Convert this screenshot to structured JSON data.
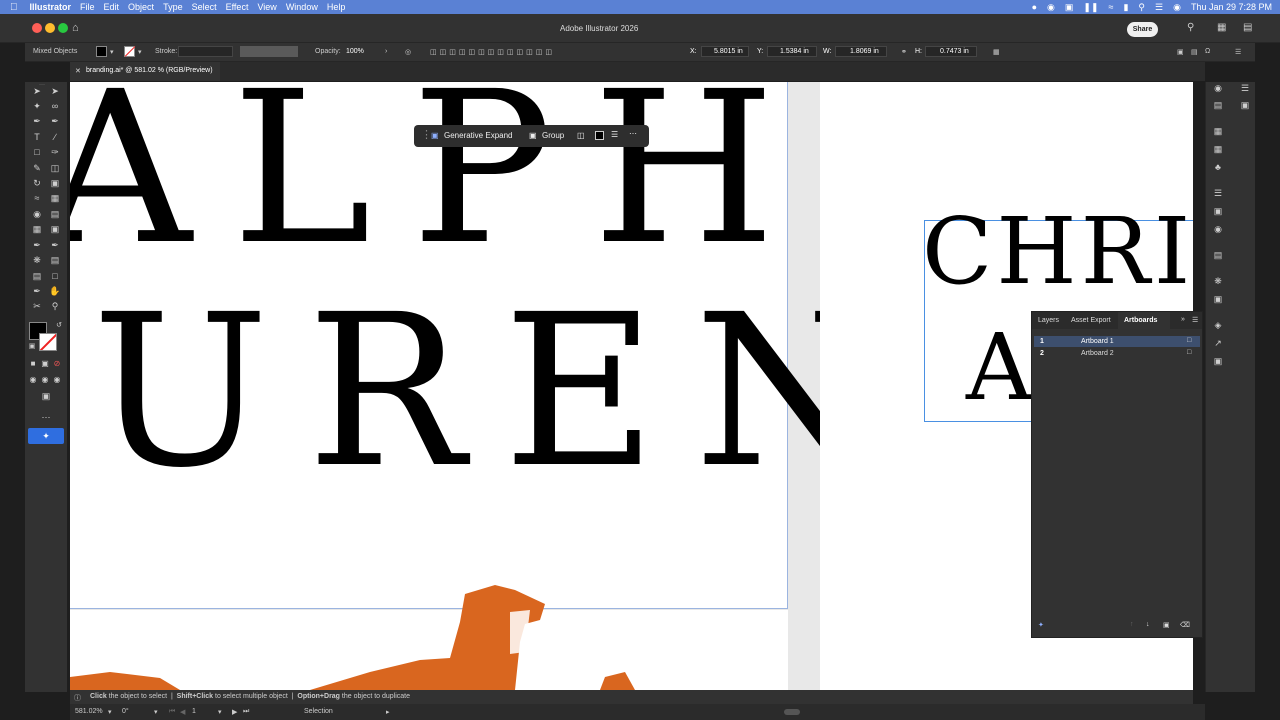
{
  "menubar": {
    "app": "Illustrator",
    "items": [
      "File",
      "Edit",
      "Object",
      "Type",
      "Select",
      "Effect",
      "View",
      "Window",
      "Help"
    ],
    "datetime": "Thu Jan 29  7:28 PM"
  },
  "window": {
    "title": "Adobe Illustrator 2026",
    "share_label": "Share"
  },
  "control": {
    "selection_type": "Mixed Objects",
    "stroke_label": "Stroke:",
    "opacity_label": "Opacity:",
    "opacity_value": "100%",
    "x_label": "X:",
    "x_value": "5.8015 in",
    "y_label": "Y:",
    "y_value": "1.5384 in",
    "w_label": "W:",
    "w_value": "1.8069 in",
    "h_label": "H:",
    "h_value": "0.7473 in"
  },
  "doc_tab": {
    "title": "branding.ai* @ 581.02 % (RGB/Preview)"
  },
  "context_bar": {
    "generative_expand": "Generative Expand",
    "group": "Group"
  },
  "canvas": {
    "line1": "ALPH",
    "line2": "UREN",
    "right_line1": "CHRIS",
    "right_line2": "A",
    "logo_color": "#d9661f"
  },
  "panel": {
    "tabs": [
      "Layers",
      "Asset Export",
      "Artboards"
    ],
    "active_tab": "Artboards",
    "artboards": [
      {
        "num": "1",
        "name": "Artboard 1"
      },
      {
        "num": "2",
        "name": "Artboard 2"
      }
    ]
  },
  "status": {
    "hint1_bold": "Click",
    "hint1": "the object to select",
    "hint2_bold": "Shift+Click",
    "hint2": "to select multiple object",
    "hint3_bold": "Option+Drag",
    "hint3": "the object to duplicate"
  },
  "bottom": {
    "zoom": "581.02%",
    "rotation": "0°",
    "artboard_num": "1",
    "tool": "Selection"
  },
  "colors": {
    "accent": "#5a81d4",
    "selection": "#4a90e2",
    "tool_active": "#2f6ee0"
  }
}
